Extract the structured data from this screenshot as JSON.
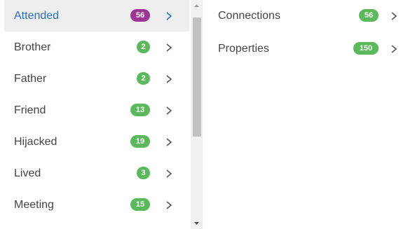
{
  "left_list": {
    "items": [
      {
        "label": "Attended",
        "count": "56",
        "selected": true
      },
      {
        "label": "Brother",
        "count": "2",
        "selected": false
      },
      {
        "label": "Father",
        "count": "2",
        "selected": false
      },
      {
        "label": "Friend",
        "count": "13",
        "selected": false
      },
      {
        "label": "Hijacked",
        "count": "19",
        "selected": false
      },
      {
        "label": "Lived",
        "count": "3",
        "selected": false
      },
      {
        "label": "Meeting",
        "count": "15",
        "selected": false
      }
    ],
    "chevron_icon": "chevron-right-icon"
  },
  "right_list": {
    "items": [
      {
        "label": "Connections",
        "count": "56"
      },
      {
        "label": "Properties",
        "count": "150"
      }
    ]
  },
  "colors": {
    "badge_green": "#5cb85c",
    "badge_purple": "#9c3596",
    "selected_text": "#2f6fb5",
    "selected_bg": "#eeeeee"
  }
}
